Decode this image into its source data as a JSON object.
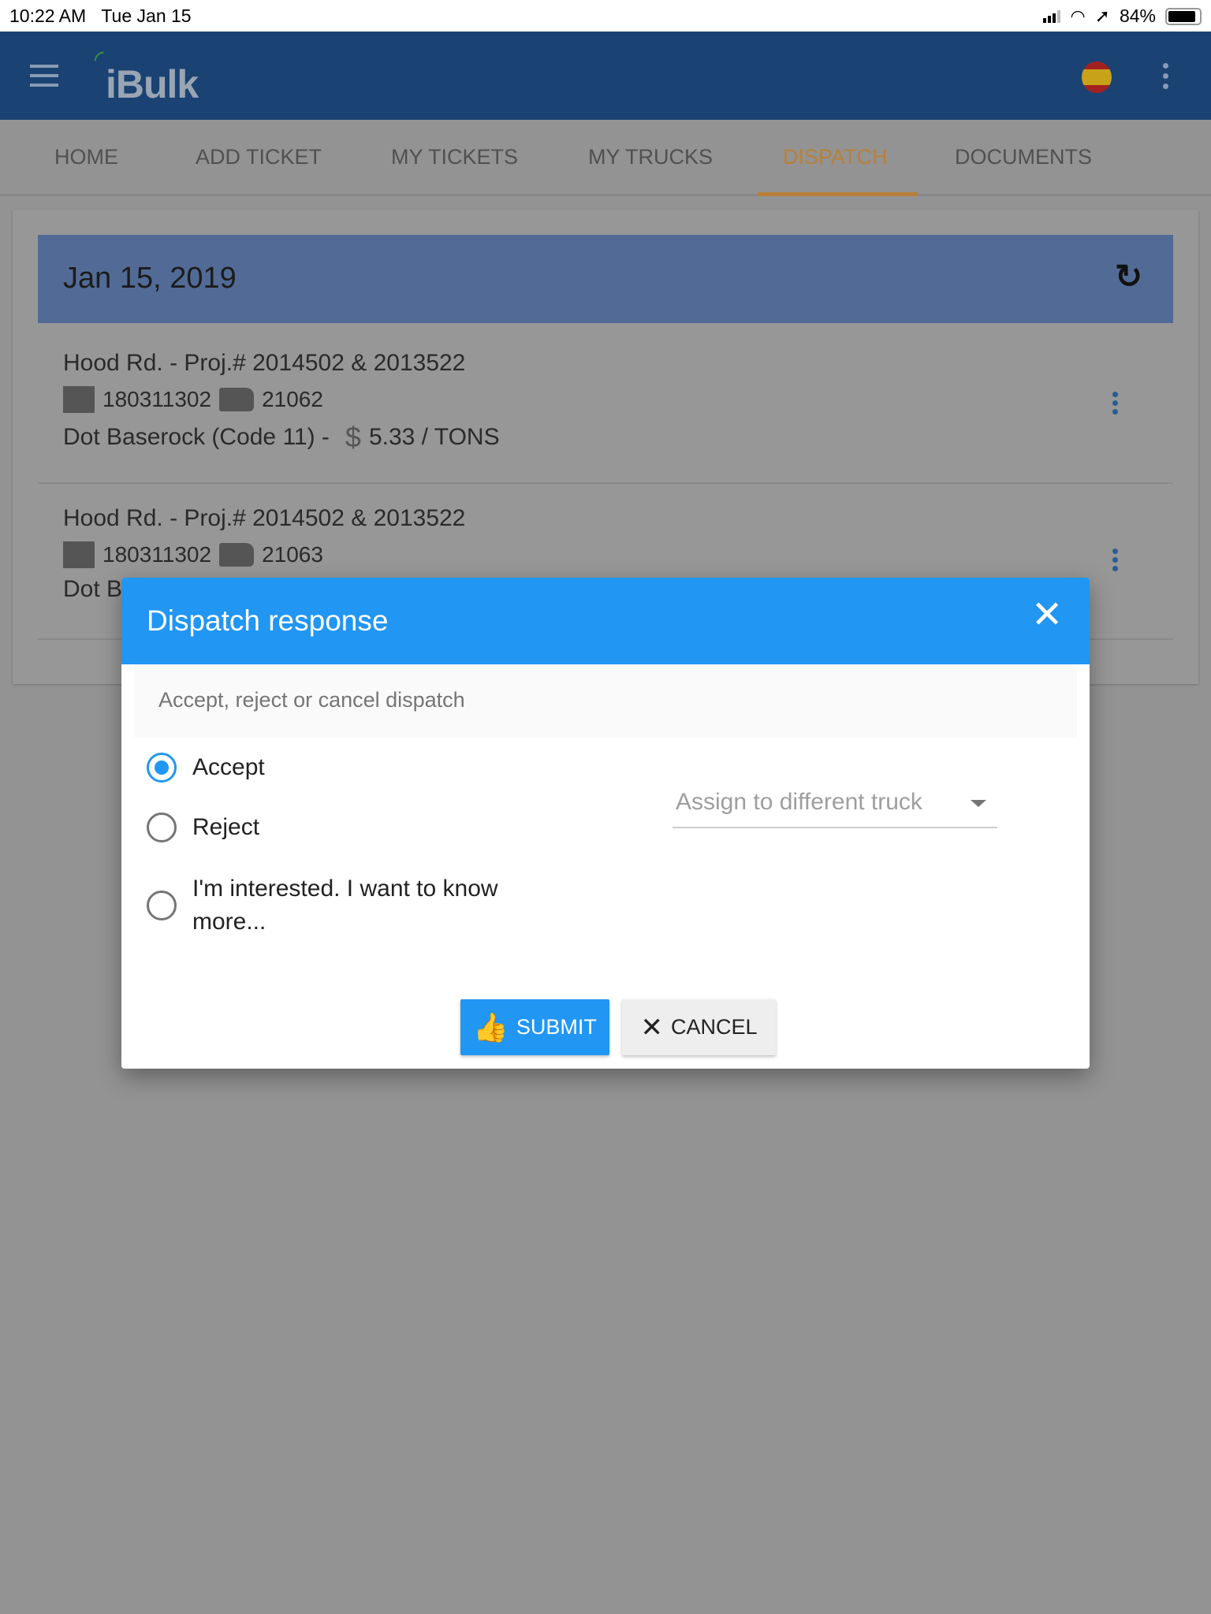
{
  "status_bar": {
    "time": "10:22 AM",
    "date": "Tue Jan 15",
    "battery": "84%"
  },
  "header": {
    "logo": "iBulk",
    "flag": "spain-flag-icon"
  },
  "tabs": [
    {
      "label": "HOME"
    },
    {
      "label": "ADD TICKET"
    },
    {
      "label": "MY TICKETS"
    },
    {
      "label": "MY TRUCKS"
    },
    {
      "label": "DISPATCH",
      "active": true
    },
    {
      "label": "DOCUMENTS"
    }
  ],
  "card": {
    "date": "Jan 15, 2019",
    "items": [
      {
        "title": "Hood Rd. - Proj.# 2014502 & 2013522",
        "company": "180311302",
        "truck": "21062",
        "material": "Dot Baserock (Code 11) -",
        "price": "5.33 / TONS"
      },
      {
        "title": "Hood Rd. - Proj.# 2014502 & 2013522",
        "company": "180311302",
        "truck": "21063",
        "material": "Dot B"
      }
    ]
  },
  "dialog": {
    "title": "Dispatch response",
    "subtitle": "Accept, reject or cancel dispatch",
    "options": [
      {
        "label": "Accept",
        "selected": true
      },
      {
        "label": "Reject",
        "selected": false
      },
      {
        "label": "I'm interested. I want to know",
        "label2": "more...",
        "selected": false
      }
    ],
    "select_placeholder": "Assign to different truck",
    "submit": "SUBMIT",
    "cancel": "CANCEL"
  },
  "colors": {
    "primary": "#2196f3",
    "header": "#1a4373",
    "active_tab": "#b8803a"
  }
}
